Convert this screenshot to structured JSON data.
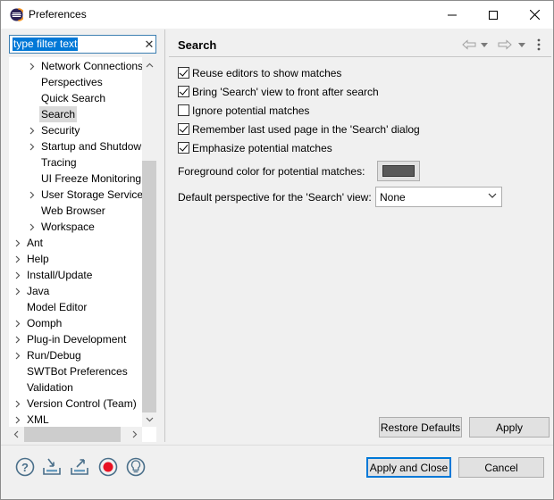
{
  "window": {
    "title": "Preferences"
  },
  "filter": {
    "value": "type filter text",
    "clear_glyph": "✕"
  },
  "tree": {
    "items": [
      {
        "label": "Network Connections",
        "expandable": true,
        "level": 2
      },
      {
        "label": "Perspectives",
        "expandable": false,
        "level": 2
      },
      {
        "label": "Quick Search",
        "expandable": false,
        "level": 2
      },
      {
        "label": "Search",
        "expandable": false,
        "level": 2,
        "selected": true
      },
      {
        "label": "Security",
        "expandable": true,
        "level": 2
      },
      {
        "label": "Startup and Shutdown",
        "expandable": true,
        "level": 2
      },
      {
        "label": "Tracing",
        "expandable": false,
        "level": 2
      },
      {
        "label": "UI Freeze Monitoring",
        "expandable": false,
        "level": 2
      },
      {
        "label": "User Storage Service",
        "expandable": true,
        "level": 2
      },
      {
        "label": "Web Browser",
        "expandable": false,
        "level": 2
      },
      {
        "label": "Workspace",
        "expandable": true,
        "level": 2
      },
      {
        "label": "Ant",
        "expandable": true,
        "level": 1
      },
      {
        "label": "Help",
        "expandable": true,
        "level": 1
      },
      {
        "label": "Install/Update",
        "expandable": true,
        "level": 1
      },
      {
        "label": "Java",
        "expandable": true,
        "level": 1
      },
      {
        "label": "Model Editor",
        "expandable": false,
        "level": 1
      },
      {
        "label": "Oomph",
        "expandable": true,
        "level": 1
      },
      {
        "label": "Plug-in Development",
        "expandable": true,
        "level": 1
      },
      {
        "label": "Run/Debug",
        "expandable": true,
        "level": 1
      },
      {
        "label": "SWTBot Preferences",
        "expandable": false,
        "level": 1
      },
      {
        "label": "Validation",
        "expandable": false,
        "level": 1
      },
      {
        "label": "Version Control (Team)",
        "expandable": true,
        "level": 1
      },
      {
        "label": "XML",
        "expandable": true,
        "level": 1
      }
    ]
  },
  "page": {
    "title": "Search",
    "options": [
      {
        "label": "Reuse editors to show matches",
        "checked": true
      },
      {
        "label": "Bring 'Search' view to front after search",
        "checked": true
      },
      {
        "label": "Ignore potential matches",
        "checked": false
      },
      {
        "label": "Remember last used page in the 'Search' dialog",
        "checked": true
      },
      {
        "label": "Emphasize potential matches",
        "checked": true
      }
    ],
    "foreground_label": "Foreground color for potential matches:",
    "foreground_color": "#595959",
    "perspective_label": "Default perspective for the 'Search' view:",
    "perspective_value": "None",
    "restore_defaults_label": "Restore Defaults",
    "apply_label": "Apply"
  },
  "footer": {
    "apply_close_label": "Apply and Close",
    "cancel_label": "Cancel",
    "icons": [
      "help-icon",
      "import-icon",
      "export-icon",
      "record-icon",
      "tip-icon"
    ]
  },
  "colors": {
    "accent": "#0078d7",
    "selected_row": "#d9d9d9",
    "record_red": "#e81123"
  }
}
